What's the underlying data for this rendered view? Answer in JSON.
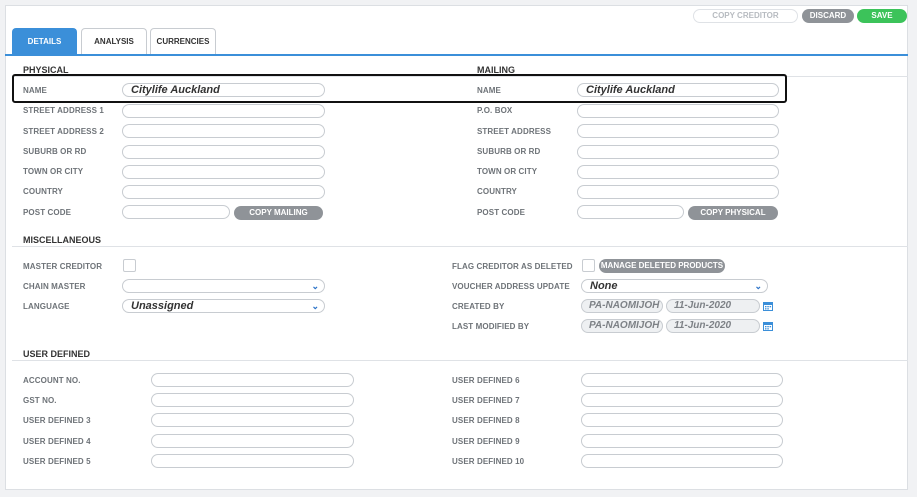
{
  "toolbar": {
    "copy_creditor": "COPY CREDITOR",
    "discard": "DISCARD",
    "save": "SAVE"
  },
  "tabs": [
    "DETAILS",
    "ANALYSIS",
    "CURRENCIES"
  ],
  "physical": {
    "heading": "PHYSICAL",
    "name_label": "NAME",
    "name_value": "Citylife Auckland",
    "street1_label": "STREET ADDRESS 1",
    "street2_label": "STREET ADDRESS 2",
    "suburb_label": "SUBURB OR RD",
    "town_label": "TOWN OR CITY",
    "country_label": "COUNTRY",
    "postcode_label": "POST CODE",
    "copy_button": "COPY MAILING"
  },
  "mailing": {
    "heading": "MAILING",
    "name_label": "NAME",
    "name_value": "Citylife Auckland",
    "pobox_label": "P.O. BOX",
    "street_label": "STREET ADDRESS",
    "suburb_label": "SUBURB OR RD",
    "town_label": "TOWN OR CITY",
    "country_label": "COUNTRY",
    "postcode_label": "POST CODE",
    "copy_button": "COPY PHYSICAL"
  },
  "misc": {
    "heading": "MISCELLANEOUS",
    "master_creditor_label": "MASTER CREDITOR",
    "chain_master_label": "CHAIN MASTER",
    "language_label": "LANGUAGE",
    "language_value": "Unassigned",
    "flag_deleted_label": "FLAG CREDITOR AS DELETED",
    "manage_deleted_button": "MANAGE DELETED PRODUCTS",
    "voucher_label": "VOUCHER ADDRESS UPDATE",
    "voucher_value": "None",
    "created_label": "CREATED BY",
    "created_user": "PA-NAOMIJOH",
    "created_date": "11-Jun-2020",
    "modified_label": "LAST MODIFIED BY",
    "modified_user": "PA-NAOMIJOH",
    "modified_date": "11-Jun-2020"
  },
  "user_defined": {
    "heading": "USER DEFINED",
    "account_label": "ACCOUNT NO.",
    "gst_label": "GST NO.",
    "ud3": "USER DEFINED 3",
    "ud4": "USER DEFINED 4",
    "ud5": "USER DEFINED 5",
    "ud6": "USER DEFINED 6",
    "ud7": "USER DEFINED 7",
    "ud8": "USER DEFINED 8",
    "ud9": "USER DEFINED 9",
    "ud10": "USER DEFINED 10"
  },
  "colors": {
    "accent": "#3b8fd9",
    "save": "#3cc35a",
    "button_grey": "#8f9398"
  }
}
